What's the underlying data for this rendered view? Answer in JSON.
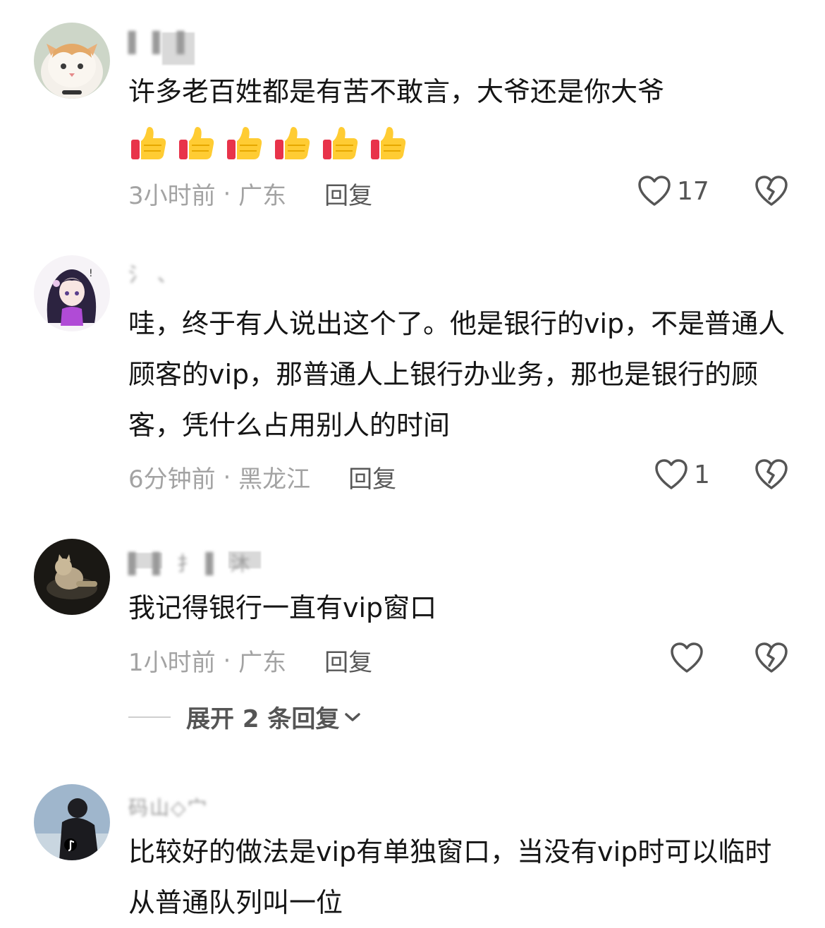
{
  "comments": [
    {
      "username": "▌ ▌ ▌",
      "text": "许多老百姓都是有苦不敢言，大爷还是你大爷",
      "emoji_count": 6,
      "emoji_name": "thumbs-up-icon",
      "time": "3小时前",
      "location": "广东",
      "reply_label": "回复",
      "like_count": "17"
    },
    {
      "username": "氵  、",
      "text": "哇，终于有人说出这个了。他是银行的vip，不是普通人顾客的vip，那普通人上银行办业务，那也是银行的顾客，凭什么占用别人的时间",
      "time": "6分钟前",
      "location": "黑龙江",
      "reply_label": "回复",
      "like_count": "1"
    },
    {
      "username": "▌  ▌ 扌 ▌ 沐 ",
      "text": "我记得银行一直有vip窗口",
      "time": "1小时前",
      "location": "广东",
      "reply_label": "回复",
      "like_count": "",
      "expand_label": "展开 2 条回复"
    },
    {
      "username": "码山◇宀",
      "text": "比较好的做法是vip有单独窗口，当没有vip时可以临时从普通队列叫一位"
    }
  ],
  "colors": {
    "text": "#151515",
    "meta": "#a3a3a3",
    "reply": "#585858",
    "icon": "#555555"
  }
}
